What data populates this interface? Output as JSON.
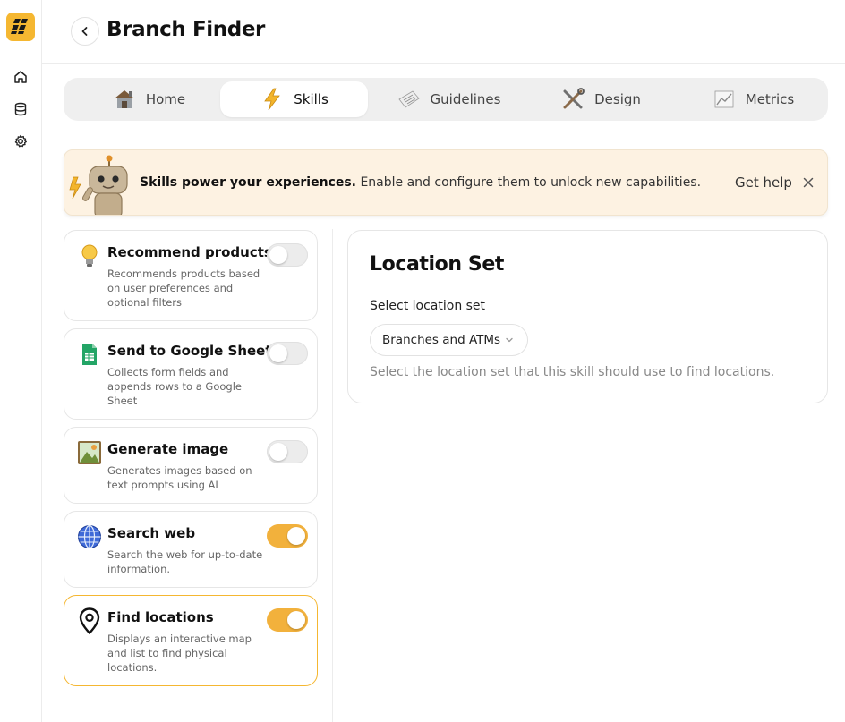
{
  "app": {
    "title": "Branch Finder"
  },
  "rail": {
    "items": [
      {
        "icon": "home-icon"
      },
      {
        "icon": "database-icon"
      },
      {
        "icon": "gear-icon"
      }
    ]
  },
  "tabs": [
    {
      "label": "Home",
      "icon": "house-icon",
      "active": false
    },
    {
      "label": "Skills",
      "icon": "lightning-icon",
      "active": true
    },
    {
      "label": "Guidelines",
      "icon": "paper-icon",
      "active": false
    },
    {
      "label": "Design",
      "icon": "tools-icon",
      "active": false
    },
    {
      "label": "Metrics",
      "icon": "chart-icon",
      "active": false
    }
  ],
  "banner": {
    "bold": "Skills power your experiences.",
    "text": " Enable and configure them to unlock new capabilities.",
    "help": "Get help"
  },
  "skills": [
    {
      "title": "Recommend products",
      "desc": "Recommends products based on user preferences and optional filters",
      "icon": "lightbulb-icon",
      "enabled": false
    },
    {
      "title": "Send to Google Sheets",
      "desc": "Collects form fields and appends rows to a Google Sheet",
      "icon": "google-sheets-icon",
      "enabled": false
    },
    {
      "title": "Generate image",
      "desc": "Generates images based on text prompts using AI",
      "icon": "picture-icon",
      "enabled": false
    },
    {
      "title": "Search web",
      "desc": "Search the web for up-to-date information.",
      "icon": "globe-icon",
      "enabled": true
    },
    {
      "title": "Find locations",
      "desc": "Displays an interactive map and list to find physical locations.",
      "icon": "map-pin-icon",
      "enabled": true
    }
  ],
  "panel": {
    "title": "Location Set",
    "label": "Select location set",
    "selected": "Branches and ATMs",
    "hint": "Select the location set that this skill should use to find locations."
  },
  "colors": {
    "accent": "#f5b731",
    "toggle_on": "#f2b13c",
    "banner_bg": "#fdf2e2"
  }
}
